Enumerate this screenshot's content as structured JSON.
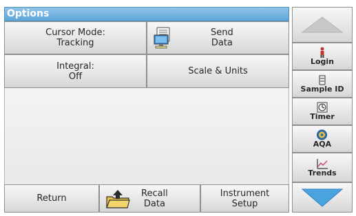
{
  "title": "Options",
  "options": {
    "cursor_mode": {
      "label": "Cursor Mode:",
      "value": "Tracking"
    },
    "send_data": {
      "line1": "Send",
      "line2": "Data",
      "icon": "computer-icon"
    },
    "integral": {
      "label": "Integral:",
      "value": "Off"
    },
    "scale_units": {
      "label": "Scale & Units"
    }
  },
  "bottom": {
    "return": "Return",
    "recall_data": {
      "line1": "Recall",
      "line2": "Data",
      "icon": "folder-upload-icon"
    },
    "instrument_setup": {
      "line1": "Instrument",
      "line2": "Setup"
    }
  },
  "sidebar": {
    "up_icon": "up-arrow-icon",
    "down_icon": "down-arrow-icon",
    "items": [
      {
        "label": "Login",
        "icon": "person-icon"
      },
      {
        "label": "Sample ID",
        "icon": "beaker-icon"
      },
      {
        "label": "Timer",
        "icon": "timer-icon"
      },
      {
        "label": "AQA",
        "icon": "aqa-icon"
      },
      {
        "label": "Trends",
        "icon": "trend-chart-icon"
      }
    ]
  },
  "colors": {
    "title_bar": "#6aaddc",
    "arrow": "#4aa3df",
    "person": "#c0392b"
  }
}
